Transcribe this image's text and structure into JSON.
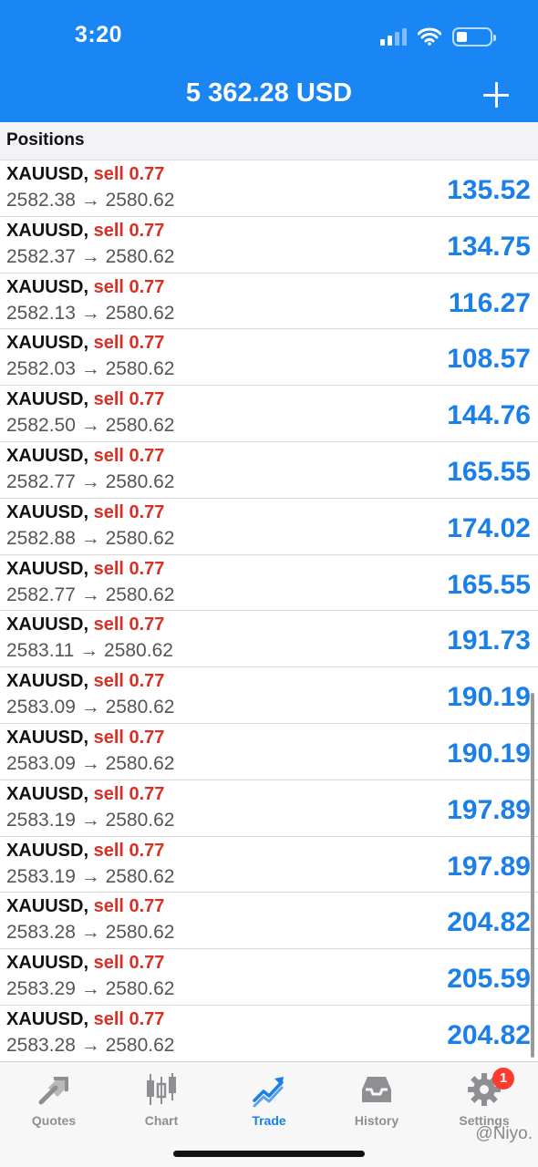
{
  "status": {
    "time": "3:20"
  },
  "header": {
    "balance": "5 362.28 USD"
  },
  "section": {
    "title": "Positions"
  },
  "positions": [
    {
      "symbol": "XAUUSD,",
      "side": "sell 0.77",
      "prices": "2582.38 → 2580.62",
      "profit": "135.52"
    },
    {
      "symbol": "XAUUSD,",
      "side": "sell 0.77",
      "prices": "2582.37 → 2580.62",
      "profit": "134.75"
    },
    {
      "symbol": "XAUUSD,",
      "side": "sell 0.77",
      "prices": "2582.13 → 2580.62",
      "profit": "116.27"
    },
    {
      "symbol": "XAUUSD,",
      "side": "sell 0.77",
      "prices": "2582.03 → 2580.62",
      "profit": "108.57"
    },
    {
      "symbol": "XAUUSD,",
      "side": "sell 0.77",
      "prices": "2582.50 → 2580.62",
      "profit": "144.76"
    },
    {
      "symbol": "XAUUSD,",
      "side": "sell 0.77",
      "prices": "2582.77 → 2580.62",
      "profit": "165.55"
    },
    {
      "symbol": "XAUUSD,",
      "side": "sell 0.77",
      "prices": "2582.88 → 2580.62",
      "profit": "174.02"
    },
    {
      "symbol": "XAUUSD,",
      "side": "sell 0.77",
      "prices": "2582.77 → 2580.62",
      "profit": "165.55"
    },
    {
      "symbol": "XAUUSD,",
      "side": "sell 0.77",
      "prices": "2583.11 → 2580.62",
      "profit": "191.73"
    },
    {
      "symbol": "XAUUSD,",
      "side": "sell 0.77",
      "prices": "2583.09 → 2580.62",
      "profit": "190.19"
    },
    {
      "symbol": "XAUUSD,",
      "side": "sell 0.77",
      "prices": "2583.09 → 2580.62",
      "profit": "190.19"
    },
    {
      "symbol": "XAUUSD,",
      "side": "sell 0.77",
      "prices": "2583.19 → 2580.62",
      "profit": "197.89"
    },
    {
      "symbol": "XAUUSD,",
      "side": "sell 0.77",
      "prices": "2583.19 → 2580.62",
      "profit": "197.89"
    },
    {
      "symbol": "XAUUSD,",
      "side": "sell 0.77",
      "prices": "2583.28 → 2580.62",
      "profit": "204.82"
    },
    {
      "symbol": "XAUUSD,",
      "side": "sell 0.77",
      "prices": "2583.29 → 2580.62",
      "profit": "205.59"
    },
    {
      "symbol": "XAUUSD,",
      "side": "sell 0.77",
      "prices": "2583.28 → 2580.62",
      "profit": "204.82"
    }
  ],
  "tabs": [
    {
      "label": "Quotes",
      "icon": "quotes-arrows-icon"
    },
    {
      "label": "Chart",
      "icon": "candlestick-icon"
    },
    {
      "label": "Trade",
      "icon": "trade-trend-icon",
      "active": true
    },
    {
      "label": "History",
      "icon": "inbox-tray-icon"
    },
    {
      "label": "Settings",
      "icon": "gear-icon",
      "badge": "1"
    }
  ],
  "watermark": "@Niyo.",
  "colors": {
    "accent": "#1a86f3",
    "sell": "#d93025",
    "profit": "#1a7fe8"
  }
}
